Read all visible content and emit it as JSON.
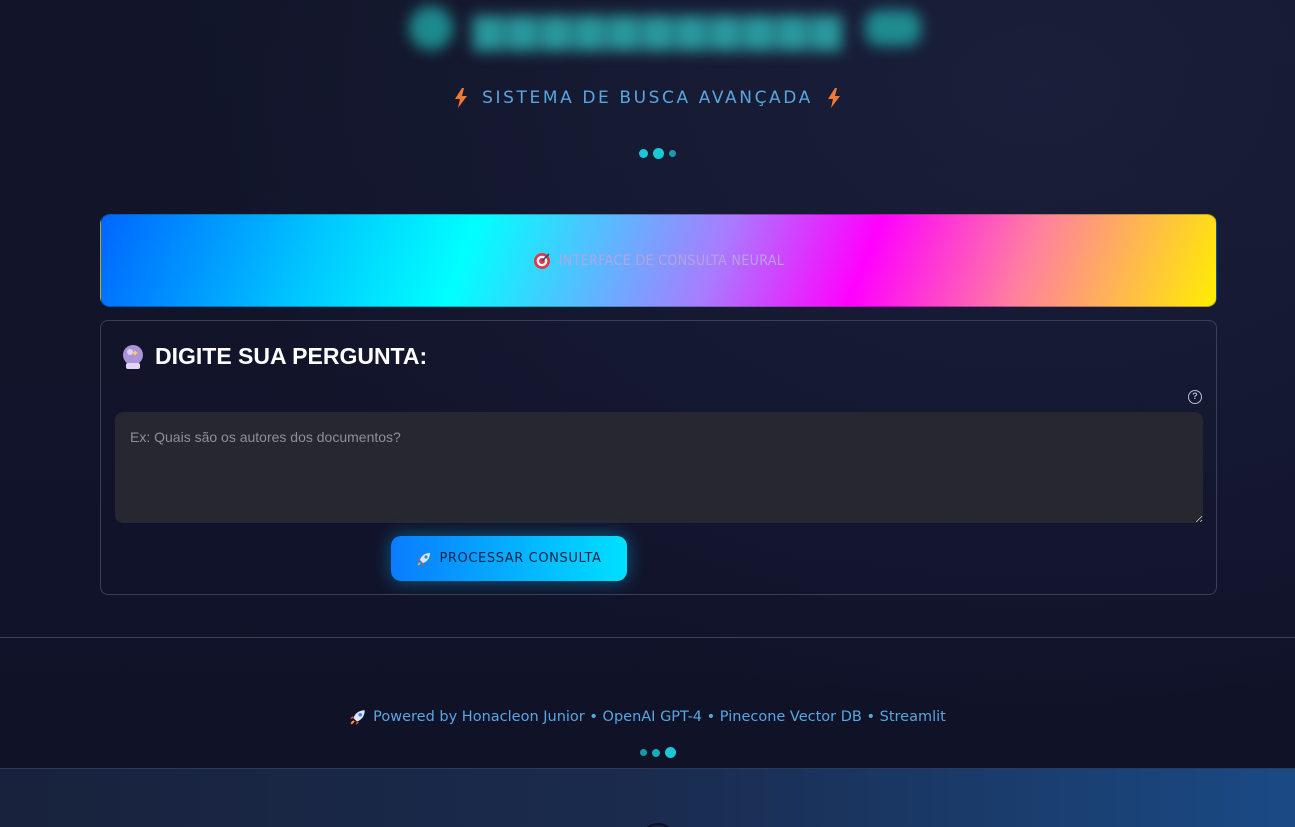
{
  "header": {
    "subtitle": "SISTEMA DE BUSCA AVANÇADA",
    "bolt_icon": "lightning-bolt-icon",
    "accent_color": "#19c8d8"
  },
  "banner": {
    "icon": "target-icon",
    "label": "INTERFACE DE CONSULTA NEURAL"
  },
  "query_card": {
    "icon": "crystal-ball-icon",
    "title": "DIGITE SUA PERGUNTA:",
    "help_icon": "help-circle-icon",
    "input_value": "",
    "input_placeholder": "Ex: Quais são os autores dos documentos?",
    "button_icon": "rocket-icon",
    "button_label": "PROCESSAR CONSULTA"
  },
  "footer": {
    "icon": "rocket-icon",
    "text": "Powered by Honacleon Junior • OpenAI GPT-4 • Pinecone Vector DB • Streamlit"
  }
}
